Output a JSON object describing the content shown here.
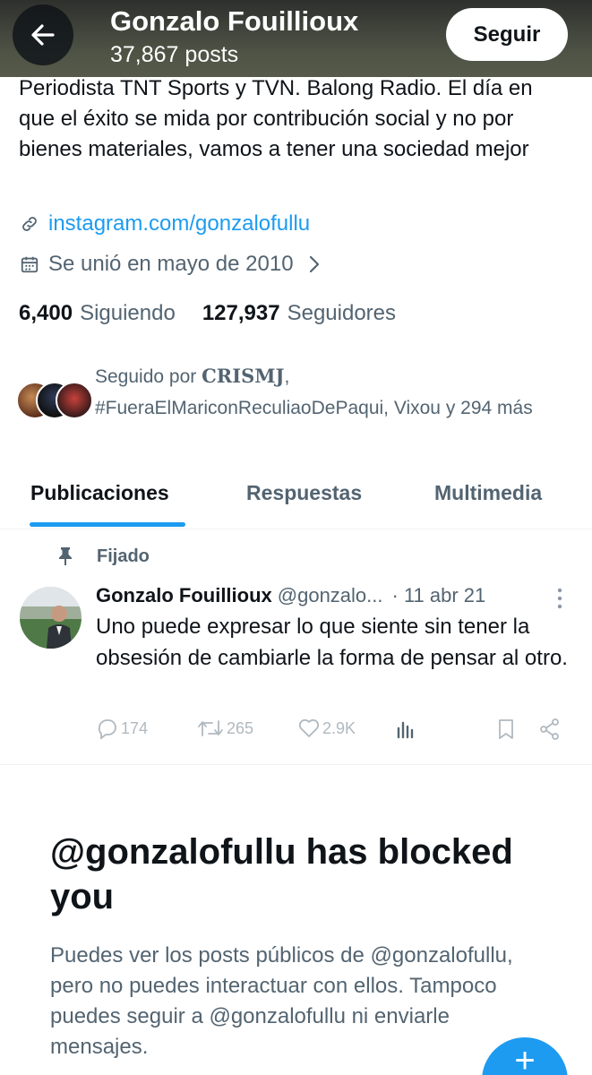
{
  "header": {
    "title": "Gonzalo Fouillioux",
    "posts_count": "37,867 posts",
    "follow_label": "Seguir"
  },
  "profile": {
    "bio": "Periodista TNT Sports y TVN. Balong Radio. El día en que el éxito se mida por contribución social y no por bienes materiales, vamos a tener una sociedad mejor",
    "link": "instagram.com/gonzalofullu",
    "joined": "Se unió en mayo de 2010",
    "following_count": "6,400",
    "following_label": "Siguiendo",
    "followers_count": "127,937",
    "followers_label": "Seguidores",
    "followed_by_prefix": "Seguido por ",
    "followed_by_strong": "CRISMJ",
    "followed_by_rest": ", #FueraElMariconReculiaoDePaqui, Vixou y 294 más"
  },
  "tabs": [
    {
      "label": "Publicaciones",
      "active": true
    },
    {
      "label": "Respuestas",
      "active": false
    },
    {
      "label": "Multimedia",
      "active": false
    }
  ],
  "tweet": {
    "pinned_label": "Fijado",
    "author": "Gonzalo Fouillioux",
    "handle": "@gonzalo...",
    "date": "· 11 abr 21",
    "text": "Uno puede expresar lo que siente sin tener la obsesión de cambiarle la forma de pensar al otro.",
    "replies": "174",
    "retweets": "265",
    "likes": "2.9K"
  },
  "blocked": {
    "title": "@gonzalofullu has blocked you",
    "message": "Puedes ver los posts públicos de @gonzalofullu, pero no puedes interactuar con ellos. Tampoco puedes seguir a @gonzalofullu ni enviarle mensajes."
  },
  "colors": {
    "accent": "#1d9bf0",
    "text_primary": "#0f1419",
    "text_secondary": "#536471"
  },
  "icons": [
    "back-arrow-icon",
    "link-icon",
    "calendar-icon",
    "chevron-right-icon",
    "pin-icon",
    "more-icon",
    "reply-icon",
    "retweet-icon",
    "like-icon",
    "views-icon",
    "bookmark-icon",
    "share-icon",
    "compose-plus-icon"
  ]
}
